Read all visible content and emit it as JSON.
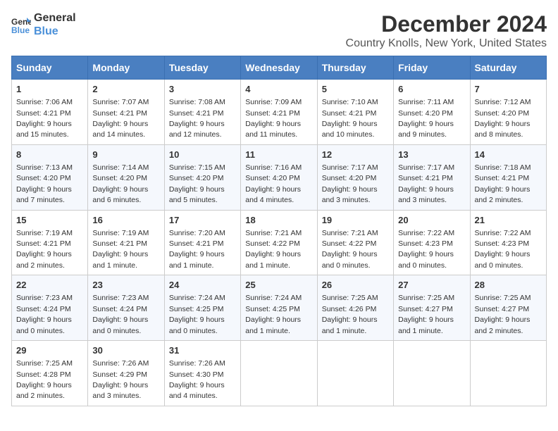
{
  "logo": {
    "general": "General",
    "blue": "Blue"
  },
  "title": "December 2024",
  "subtitle": "Country Knolls, New York, United States",
  "days_header": [
    "Sunday",
    "Monday",
    "Tuesday",
    "Wednesday",
    "Thursday",
    "Friday",
    "Saturday"
  ],
  "weeks": [
    [
      {
        "day": "1",
        "sunrise": "7:06 AM",
        "sunset": "4:21 PM",
        "daylight": "9 hours and 15 minutes."
      },
      {
        "day": "2",
        "sunrise": "7:07 AM",
        "sunset": "4:21 PM",
        "daylight": "9 hours and 14 minutes."
      },
      {
        "day": "3",
        "sunrise": "7:08 AM",
        "sunset": "4:21 PM",
        "daylight": "9 hours and 12 minutes."
      },
      {
        "day": "4",
        "sunrise": "7:09 AM",
        "sunset": "4:21 PM",
        "daylight": "9 hours and 11 minutes."
      },
      {
        "day": "5",
        "sunrise": "7:10 AM",
        "sunset": "4:21 PM",
        "daylight": "9 hours and 10 minutes."
      },
      {
        "day": "6",
        "sunrise": "7:11 AM",
        "sunset": "4:20 PM",
        "daylight": "9 hours and 9 minutes."
      },
      {
        "day": "7",
        "sunrise": "7:12 AM",
        "sunset": "4:20 PM",
        "daylight": "9 hours and 8 minutes."
      }
    ],
    [
      {
        "day": "8",
        "sunrise": "7:13 AM",
        "sunset": "4:20 PM",
        "daylight": "9 hours and 7 minutes."
      },
      {
        "day": "9",
        "sunrise": "7:14 AM",
        "sunset": "4:20 PM",
        "daylight": "9 hours and 6 minutes."
      },
      {
        "day": "10",
        "sunrise": "7:15 AM",
        "sunset": "4:20 PM",
        "daylight": "9 hours and 5 minutes."
      },
      {
        "day": "11",
        "sunrise": "7:16 AM",
        "sunset": "4:20 PM",
        "daylight": "9 hours and 4 minutes."
      },
      {
        "day": "12",
        "sunrise": "7:17 AM",
        "sunset": "4:20 PM",
        "daylight": "9 hours and 3 minutes."
      },
      {
        "day": "13",
        "sunrise": "7:17 AM",
        "sunset": "4:21 PM",
        "daylight": "9 hours and 3 minutes."
      },
      {
        "day": "14",
        "sunrise": "7:18 AM",
        "sunset": "4:21 PM",
        "daylight": "9 hours and 2 minutes."
      }
    ],
    [
      {
        "day": "15",
        "sunrise": "7:19 AM",
        "sunset": "4:21 PM",
        "daylight": "9 hours and 2 minutes."
      },
      {
        "day": "16",
        "sunrise": "7:19 AM",
        "sunset": "4:21 PM",
        "daylight": "9 hours and 1 minute."
      },
      {
        "day": "17",
        "sunrise": "7:20 AM",
        "sunset": "4:21 PM",
        "daylight": "9 hours and 1 minute."
      },
      {
        "day": "18",
        "sunrise": "7:21 AM",
        "sunset": "4:22 PM",
        "daylight": "9 hours and 1 minute."
      },
      {
        "day": "19",
        "sunrise": "7:21 AM",
        "sunset": "4:22 PM",
        "daylight": "9 hours and 0 minutes."
      },
      {
        "day": "20",
        "sunrise": "7:22 AM",
        "sunset": "4:23 PM",
        "daylight": "9 hours and 0 minutes."
      },
      {
        "day": "21",
        "sunrise": "7:22 AM",
        "sunset": "4:23 PM",
        "daylight": "9 hours and 0 minutes."
      }
    ],
    [
      {
        "day": "22",
        "sunrise": "7:23 AM",
        "sunset": "4:24 PM",
        "daylight": "9 hours and 0 minutes."
      },
      {
        "day": "23",
        "sunrise": "7:23 AM",
        "sunset": "4:24 PM",
        "daylight": "9 hours and 0 minutes."
      },
      {
        "day": "24",
        "sunrise": "7:24 AM",
        "sunset": "4:25 PM",
        "daylight": "9 hours and 0 minutes."
      },
      {
        "day": "25",
        "sunrise": "7:24 AM",
        "sunset": "4:25 PM",
        "daylight": "9 hours and 1 minute."
      },
      {
        "day": "26",
        "sunrise": "7:25 AM",
        "sunset": "4:26 PM",
        "daylight": "9 hours and 1 minute."
      },
      {
        "day": "27",
        "sunrise": "7:25 AM",
        "sunset": "4:27 PM",
        "daylight": "9 hours and 1 minute."
      },
      {
        "day": "28",
        "sunrise": "7:25 AM",
        "sunset": "4:27 PM",
        "daylight": "9 hours and 2 minutes."
      }
    ],
    [
      {
        "day": "29",
        "sunrise": "7:25 AM",
        "sunset": "4:28 PM",
        "daylight": "9 hours and 2 minutes."
      },
      {
        "day": "30",
        "sunrise": "7:26 AM",
        "sunset": "4:29 PM",
        "daylight": "9 hours and 3 minutes."
      },
      {
        "day": "31",
        "sunrise": "7:26 AM",
        "sunset": "4:30 PM",
        "daylight": "9 hours and 4 minutes."
      },
      null,
      null,
      null,
      null
    ]
  ],
  "labels": {
    "sunrise": "Sunrise:",
    "sunset": "Sunset:",
    "daylight": "Daylight:"
  }
}
